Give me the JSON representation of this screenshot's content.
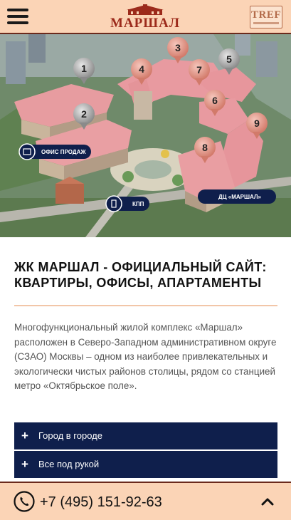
{
  "header": {
    "menu_icon": "hamburger-menu-icon",
    "logo_text": "МАРШАЛ",
    "partner_logo_text": "TREF"
  },
  "map": {
    "pins": [
      "1",
      "2",
      "3",
      "4",
      "5",
      "6",
      "7",
      "8",
      "9"
    ],
    "labels": {
      "sales_office": "ОФИС ПРОДАЖ",
      "checkpoint": "КПП",
      "business_center": "ДЦ «МАРШАЛ»"
    }
  },
  "main": {
    "title": "ЖК Маршал - официальный сайт: квартиры, офисы, апартаменты",
    "description": "Многофункциональный жилой комплекс «Маршал» расположен в Северо-Западном административном округе (СЗАО) Москвы – одном из наиболее привлекательных и экологически чистых районов столицы, рядом со станцией метро «Октябрьское поле».",
    "accordion": [
      {
        "icon": "+",
        "label": "Город в городе"
      },
      {
        "icon": "+",
        "label": "Все под рукой"
      }
    ]
  },
  "footer": {
    "phone_icon": "phone-icon",
    "phone": "+7 (495) 151-92-63",
    "scroll_up_icon": "chevron-up-icon"
  },
  "colors": {
    "header_bg": "#fbd4b6",
    "accent_dark_red": "#9c2a1b",
    "accordion_bg": "#0f1f4c",
    "divider": "#f2c6a8"
  }
}
